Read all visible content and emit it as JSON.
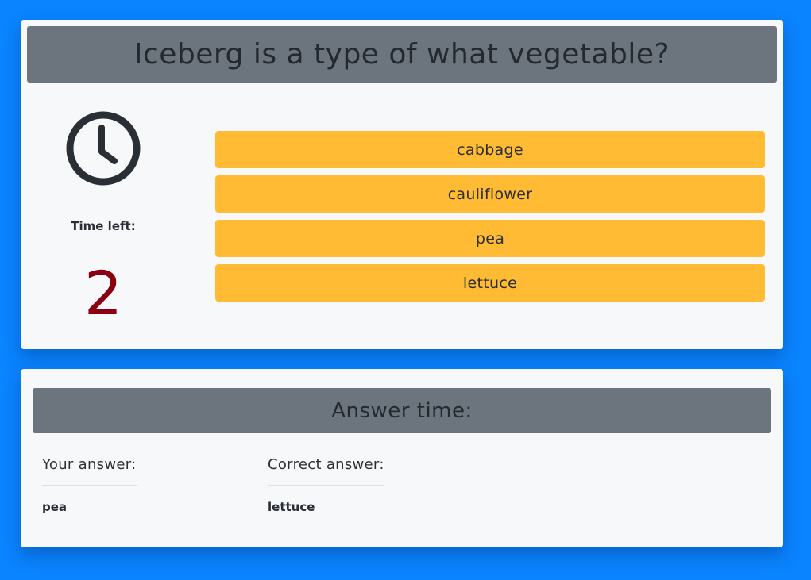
{
  "quiz": {
    "question": "Iceberg is a type of what vegetable?",
    "timer": {
      "icon": "clock-icon",
      "label": "Time left:",
      "value": "2"
    },
    "answers": [
      {
        "label": "cabbage"
      },
      {
        "label": "cauliflower"
      },
      {
        "label": "pea"
      },
      {
        "label": "lettuce"
      }
    ]
  },
  "result": {
    "header": "Answer time:",
    "your_answer_label": "Your answer:",
    "your_answer_value": "pea",
    "correct_answer_label": "Correct answer:",
    "correct_answer_value": "lettuce"
  },
  "colors": {
    "page_background": "#0a84ff",
    "card_background": "#f7f8fa",
    "header_background": "#6c757d",
    "answer_button": "#ffbb33",
    "timer_value": "#8b0010"
  }
}
